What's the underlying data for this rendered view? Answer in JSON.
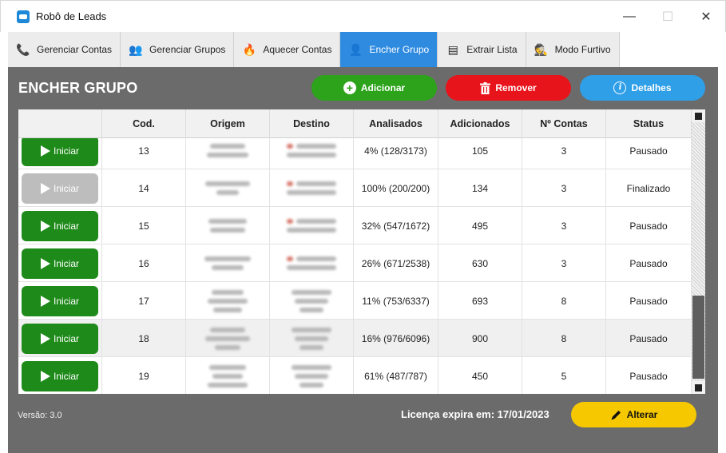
{
  "window": {
    "title": "Robô de Leads",
    "controls": {
      "minimize": "—",
      "maximize": "☐",
      "close": "✕"
    }
  },
  "tabs": [
    {
      "label": "Gerenciar Contas",
      "icon": "phone-icon",
      "glyph": "📞"
    },
    {
      "label": "Gerenciar Grupos",
      "icon": "group-icon",
      "glyph": "👥"
    },
    {
      "label": "Aquecer Contas",
      "icon": "fire-icon",
      "glyph": "🔥"
    },
    {
      "label": "Encher Grupo",
      "icon": "add-users-icon",
      "glyph": "👤",
      "active": true
    },
    {
      "label": "Extrair Lista",
      "icon": "document-icon",
      "glyph": "▤"
    },
    {
      "label": "Modo Furtivo",
      "icon": "spy-icon",
      "glyph": "🕵"
    }
  ],
  "main": {
    "title": "ENCHER GRUPO",
    "buttons": {
      "add": "Adicionar",
      "remove": "Remover",
      "details": "Detalhes",
      "alter": "Alterar"
    },
    "version": "Versão: 3.0",
    "license": "Licença expira em: 17/01/2023"
  },
  "table": {
    "columns": [
      "",
      "Cod.",
      "Origem",
      "Destino",
      "Analisados",
      "Adicionados",
      "Nº Contas",
      "Status"
    ],
    "rows": [
      {
        "action": "Iniciar",
        "enabled": true,
        "cod": "13",
        "analisados": "4% (128/3173)",
        "adicionados": "105",
        "contas": "3",
        "status": "Pausado"
      },
      {
        "action": "Iniciar",
        "enabled": false,
        "cod": "14",
        "analisados": "100% (200/200)",
        "adicionados": "134",
        "contas": "3",
        "status": "Finalizado"
      },
      {
        "action": "Iniciar",
        "enabled": true,
        "cod": "15",
        "analisados": "32% (547/1672)",
        "adicionados": "495",
        "contas": "3",
        "status": "Pausado"
      },
      {
        "action": "Iniciar",
        "enabled": true,
        "cod": "16",
        "analisados": "26% (671/2538)",
        "adicionados": "630",
        "contas": "3",
        "status": "Pausado"
      },
      {
        "action": "Iniciar",
        "enabled": true,
        "cod": "17",
        "analisados": "11% (753/6337)",
        "adicionados": "693",
        "contas": "8",
        "status": "Pausado"
      },
      {
        "action": "Iniciar",
        "enabled": true,
        "cod": "18",
        "analisados": "16% (976/6096)",
        "adicionados": "900",
        "contas": "8",
        "status": "Pausado"
      },
      {
        "action": "Iniciar",
        "enabled": true,
        "cod": "19",
        "analisados": "61% (487/787)",
        "adicionados": "450",
        "contas": "5",
        "status": "Pausado"
      }
    ]
  },
  "colors": {
    "add": "#2ca31a",
    "remove": "#e8141b",
    "details": "#2f9fe8",
    "alter": "#f5c800",
    "activeTab": "#2f8be0",
    "panel": "#6b6b6b"
  }
}
